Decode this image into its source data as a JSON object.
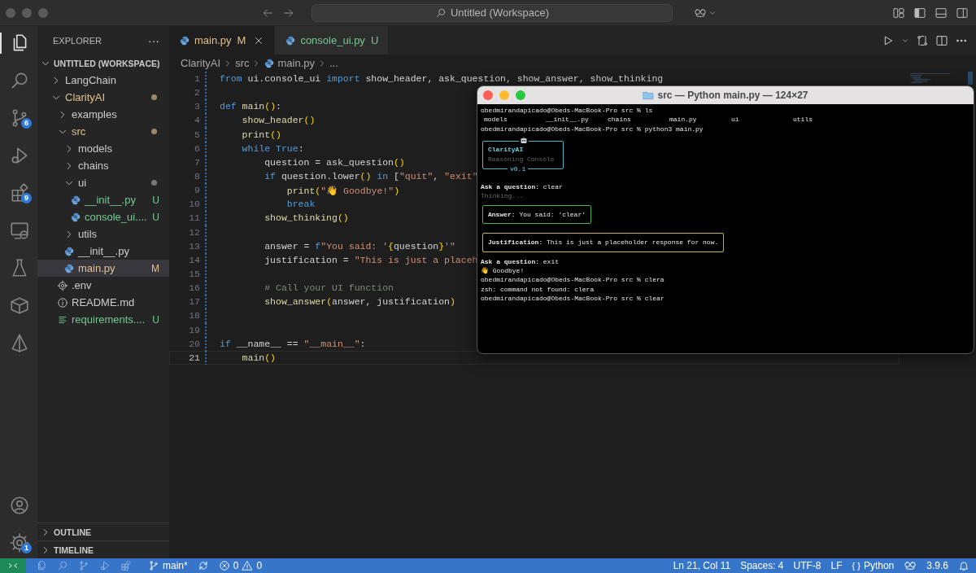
{
  "title_bar": {
    "search": "Untitled (Workspace)"
  },
  "activity_bar": {
    "top": [
      {
        "kind": "explorer",
        "selected": true
      },
      {
        "kind": "search",
        "selected": false
      },
      {
        "kind": "scm",
        "selected": false,
        "badge": "6"
      },
      {
        "kind": "run",
        "selected": false
      },
      {
        "kind": "extensions",
        "selected": false,
        "badge": "9"
      },
      {
        "kind": "remote",
        "selected": false
      },
      {
        "kind": "testing",
        "selected": false
      },
      {
        "kind": "containers",
        "selected": false
      },
      {
        "kind": "pyramid",
        "selected": false
      }
    ],
    "bottom": [
      {
        "kind": "account",
        "selected": false
      },
      {
        "kind": "settings",
        "selected": false,
        "badge": "1"
      }
    ]
  },
  "sidebar": {
    "title": "EXPLORER",
    "more": "···",
    "workspace": {
      "label": "UNTITLED (WORKSPACE)",
      "expanded": true,
      "items": [
        {
          "kind": "folder",
          "label": "LangChain",
          "expanded": false,
          "selected": false,
          "modified": false,
          "untracked": false,
          "dot": false
        },
        {
          "kind": "folder",
          "label": "ClarityAI",
          "expanded": true,
          "selected": false,
          "modified": true,
          "untracked": false,
          "dot": true,
          "children": [
            {
              "kind": "folder",
              "label": "examples",
              "expanded": false,
              "selected": false,
              "modified": false,
              "untracked": false,
              "dot": false
            },
            {
              "kind": "folder",
              "label": "src",
              "expanded": true,
              "selected": false,
              "modified": true,
              "untracked": false,
              "dot": true,
              "children": [
                {
                  "kind": "folder",
                  "label": "models",
                  "expanded": false,
                  "selected": false,
                  "modified": false,
                  "untracked": false,
                  "dot": false
                },
                {
                  "kind": "folder",
                  "label": "chains",
                  "expanded": false,
                  "selected": false,
                  "modified": false,
                  "untracked": false,
                  "dot": false
                },
                {
                  "kind": "folder",
                  "label": "ui",
                  "expanded": true,
                  "selected": false,
                  "modified": false,
                  "untracked": false,
                  "dot": true,
                  "children": [
                    {
                      "kind": "python",
                      "label": "__init__.py",
                      "selected": false,
                      "modified": false,
                      "untracked": true,
                      "badge": "U"
                    },
                    {
                      "kind": "python",
                      "label": "console_ui....",
                      "selected": false,
                      "modified": false,
                      "untracked": true,
                      "badge": "U"
                    }
                  ]
                },
                {
                  "kind": "folder",
                  "label": "utils",
                  "expanded": false,
                  "selected": false,
                  "modified": false,
                  "untracked": false,
                  "dot": false
                },
                {
                  "kind": "python",
                  "label": "__init__.py",
                  "selected": false,
                  "modified": false,
                  "untracked": false
                },
                {
                  "kind": "python",
                  "label": "main.py",
                  "selected": true,
                  "modified": true,
                  "untracked": false,
                  "badge": "M"
                }
              ]
            },
            {
              "kind": "env",
              "label": ".env",
              "selected": false,
              "modified": false,
              "untracked": false
            },
            {
              "kind": "readme",
              "label": "README.md",
              "selected": false,
              "modified": false,
              "untracked": false
            },
            {
              "kind": "text",
              "label": "requirements....",
              "selected": false,
              "modified": false,
              "untracked": true,
              "badge": "U"
            }
          ]
        }
      ]
    },
    "sections": [
      {
        "label": "OUTLINE",
        "expanded": false
      },
      {
        "label": "TIMELINE",
        "expanded": false
      }
    ]
  },
  "tabs": [
    {
      "label": "main.py",
      "badge": "M",
      "modified": true,
      "selected": true
    },
    {
      "label": "console_ui.py",
      "badge": "U",
      "modified": false,
      "selected": false
    }
  ],
  "breadcrumb": [
    "ClarityAI",
    "src",
    "main.py",
    "..."
  ],
  "code": [
    {
      "number": "1",
      "current": false,
      "tokens": [
        {
          "kind": "kw",
          "text": "from"
        },
        {
          "kind": "plain",
          "text": " ui.console_ui "
        },
        {
          "kind": "kw",
          "text": "import"
        },
        {
          "kind": "plain",
          "text": " show_header, ask_question, show_answer, show_thinking"
        }
      ]
    },
    {
      "number": "2",
      "current": false
    },
    {
      "number": "3",
      "current": false,
      "tokens": [
        {
          "kind": "kw",
          "text": "def"
        },
        {
          "kind": "fn",
          "text": " main"
        },
        {
          "kind": "brace",
          "text": "()"
        },
        {
          "kind": "plain",
          "text": ":"
        }
      ]
    },
    {
      "number": "4",
      "current": false,
      "tokens": [
        {
          "kind": "fn",
          "text": "    show_header"
        },
        {
          "kind": "brace",
          "text": "()"
        }
      ]
    },
    {
      "number": "5",
      "current": false,
      "tokens": [
        {
          "kind": "fn",
          "text": "    print"
        },
        {
          "kind": "brace",
          "text": "()"
        }
      ]
    },
    {
      "number": "6",
      "current": false,
      "tokens": [
        {
          "kind": "kw",
          "text": "    while"
        },
        {
          "kind": "kw",
          "text": " True"
        },
        {
          "kind": "plain",
          "text": ":"
        }
      ]
    },
    {
      "number": "7",
      "current": false,
      "tokens": [
        {
          "kind": "plain",
          "text": "        question = ask_question"
        },
        {
          "kind": "brace",
          "text": "()"
        }
      ]
    },
    {
      "number": "8",
      "current": false,
      "tokens": [
        {
          "kind": "kw",
          "text": "        if"
        },
        {
          "kind": "plain",
          "text": " question.lower"
        },
        {
          "kind": "brace",
          "text": "()"
        },
        {
          "kind": "kw",
          "text": " in"
        },
        {
          "kind": "plain",
          "text": " ["
        },
        {
          "kind": "str",
          "text": "\"quit\""
        },
        {
          "kind": "plain",
          "text": ", "
        },
        {
          "kind": "str",
          "text": "\"exit\""
        }
      ]
    },
    {
      "number": "9",
      "current": false,
      "tokens": [
        {
          "kind": "fn",
          "text": "            print"
        },
        {
          "kind": "brace",
          "text": "("
        },
        {
          "kind": "str",
          "text": "\"👋 Goodbye!\""
        },
        {
          "kind": "brace",
          "text": ")"
        }
      ]
    },
    {
      "number": "10",
      "current": false,
      "tokens": [
        {
          "kind": "kw",
          "text": "            break"
        }
      ]
    },
    {
      "number": "11",
      "current": false,
      "tokens": [
        {
          "kind": "fn",
          "text": "        show_thinking"
        },
        {
          "kind": "brace",
          "text": "()"
        }
      ]
    },
    {
      "number": "12",
      "current": false
    },
    {
      "number": "13",
      "current": false,
      "tokens": [
        {
          "kind": "plain",
          "text": "        answer = "
        },
        {
          "kind": "kw",
          "text": "f"
        },
        {
          "kind": "str",
          "text": "\"You said: '"
        },
        {
          "kind": "brace",
          "text": "{"
        },
        {
          "kind": "plain",
          "text": "question"
        },
        {
          "kind": "brace",
          "text": "}"
        },
        {
          "kind": "str",
          "text": "'\""
        }
      ]
    },
    {
      "number": "14",
      "current": false,
      "tokens": [
        {
          "kind": "plain",
          "text": "        justification = "
        },
        {
          "kind": "str",
          "text": "\"This is just a placeh"
        }
      ]
    },
    {
      "number": "15",
      "current": false
    },
    {
      "number": "16",
      "current": false,
      "tokens": [
        {
          "kind": "comment",
          "text": "        # Call your UI function"
        }
      ]
    },
    {
      "number": "17",
      "current": false,
      "tokens": [
        {
          "kind": "fn",
          "text": "        show_answer"
        },
        {
          "kind": "brace",
          "text": "("
        },
        {
          "kind": "plain",
          "text": "answer, justification"
        },
        {
          "kind": "brace",
          "text": ")"
        }
      ]
    },
    {
      "number": "18",
      "current": false
    },
    {
      "number": "19",
      "current": false
    },
    {
      "number": "20",
      "current": false,
      "tokens": [
        {
          "kind": "kw",
          "text": "if"
        },
        {
          "kind": "plain",
          "text": " __name__ == "
        },
        {
          "kind": "str",
          "text": "\"__main__\""
        },
        {
          "kind": "plain",
          "text": ":"
        }
      ]
    },
    {
      "number": "21",
      "current": true,
      "tokens": [
        {
          "kind": "fn",
          "text": "    main"
        },
        {
          "kind": "brace",
          "text": "()"
        }
      ]
    }
  ],
  "terminal": {
    "title": "src — Python main.py — 124×27",
    "lines": [
      {
        "kind": "prompt",
        "text": "obedmirandapicado@Obeds-MacBook-Pro src % ls"
      },
      {
        "kind": "listing",
        "items": [
          "models",
          "__init__.py",
          "chains",
          "main.py",
          "ui",
          "utils"
        ]
      },
      {
        "kind": "prompt",
        "text": "obedmirandapicado@Obeds-MacBook-Pro src % python3 main.py"
      },
      {
        "kind": "banner",
        "title": "ClarityAI",
        "subtitle": "Reasoning Console",
        "version": "v0.1"
      },
      {
        "kind": "text",
        "text": "**Ask a question:** clear"
      },
      {
        "kind": "dim",
        "text": "Thinking..."
      },
      {
        "kind": "panel",
        "color": "#4caf50",
        "text": "**Answer:** You said: 'clear'"
      },
      {
        "kind": "panel",
        "color": "#c8b43c",
        "text": "**Justification:** This is just a placeholder response for now."
      },
      {
        "kind": "text",
        "text": "**Ask a question:** exit"
      },
      {
        "kind": "text",
        "text": "👋 Goodbye!"
      },
      {
        "kind": "prompt",
        "text": "obedmirandapicado@Obeds-MacBook-Pro src % clera"
      },
      {
        "kind": "text",
        "text": "zsh: command not found: clera"
      },
      {
        "kind": "prompt",
        "text": "obedmirandapicado@Obeds-MacBook-Pro src % clear"
      }
    ]
  },
  "status_bar": {
    "branch": "main*",
    "errors": "0",
    "warnings": "0",
    "cursor": "Ln 21, Col 11",
    "indent": "Spaces: 4",
    "encoding": "UTF-8",
    "eol": "LF",
    "language_icon": "{ }",
    "language": "Python",
    "python_version": "3.9.6"
  }
}
